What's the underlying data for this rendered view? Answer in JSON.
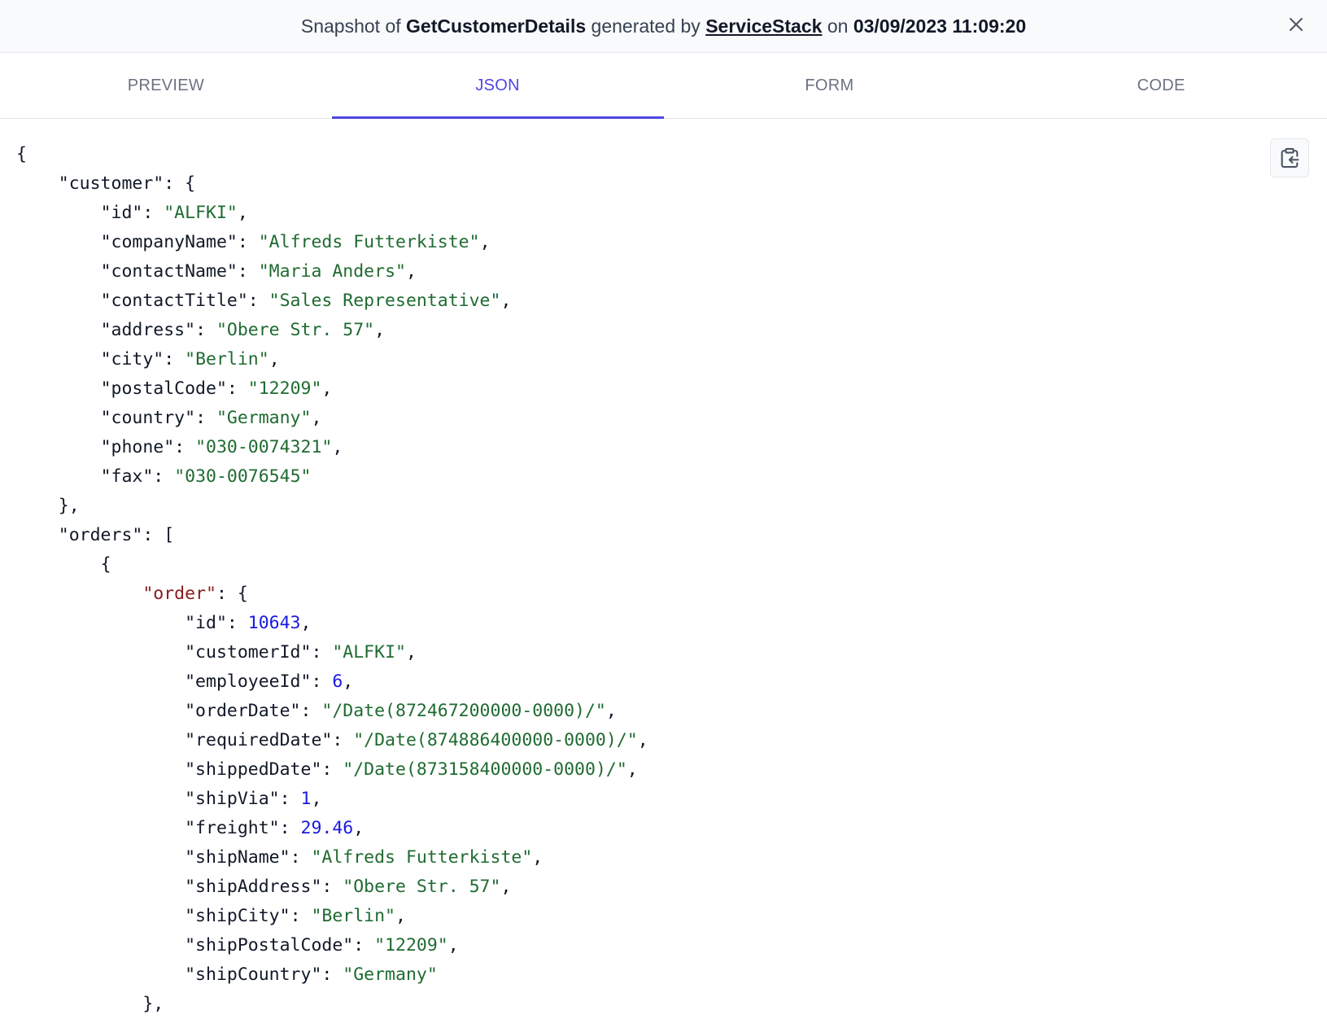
{
  "header": {
    "snapshot_prefix": "Snapshot of",
    "operation": "GetCustomerDetails",
    "generated_by": "generated by",
    "generator": "ServiceStack",
    "on": "on",
    "timestamp": "03/09/2023 11:09:20",
    "close_icon": "close-icon"
  },
  "tabs": [
    {
      "label": "PREVIEW",
      "active": false
    },
    {
      "label": "JSON",
      "active": true
    },
    {
      "label": "FORM",
      "active": false
    },
    {
      "label": "CODE",
      "active": false
    }
  ],
  "copy_icon": "clipboard-copy-icon",
  "colors": {
    "accent": "#4f46e5",
    "string": "#1f6b31",
    "number": "#1a1adf",
    "nested_key": "#8b1a1a"
  },
  "json_lines": [
    {
      "indent": 0,
      "parts": [
        {
          "t": "{",
          "c": "p"
        }
      ]
    },
    {
      "indent": 1,
      "parts": [
        {
          "t": "\"customer\"",
          "c": "k"
        },
        {
          "t": ": {",
          "c": "p"
        }
      ]
    },
    {
      "indent": 2,
      "parts": [
        {
          "t": "\"id\"",
          "c": "k"
        },
        {
          "t": ": ",
          "c": "p"
        },
        {
          "t": "\"ALFKI\"",
          "c": "s"
        },
        {
          "t": ",",
          "c": "p"
        }
      ]
    },
    {
      "indent": 2,
      "parts": [
        {
          "t": "\"companyName\"",
          "c": "k"
        },
        {
          "t": ": ",
          "c": "p"
        },
        {
          "t": "\"Alfreds Futterkiste\"",
          "c": "s"
        },
        {
          "t": ",",
          "c": "p"
        }
      ]
    },
    {
      "indent": 2,
      "parts": [
        {
          "t": "\"contactName\"",
          "c": "k"
        },
        {
          "t": ": ",
          "c": "p"
        },
        {
          "t": "\"Maria Anders\"",
          "c": "s"
        },
        {
          "t": ",",
          "c": "p"
        }
      ]
    },
    {
      "indent": 2,
      "parts": [
        {
          "t": "\"contactTitle\"",
          "c": "k"
        },
        {
          "t": ": ",
          "c": "p"
        },
        {
          "t": "\"Sales Representative\"",
          "c": "s"
        },
        {
          "t": ",",
          "c": "p"
        }
      ]
    },
    {
      "indent": 2,
      "parts": [
        {
          "t": "\"address\"",
          "c": "k"
        },
        {
          "t": ": ",
          "c": "p"
        },
        {
          "t": "\"Obere Str. 57\"",
          "c": "s"
        },
        {
          "t": ",",
          "c": "p"
        }
      ]
    },
    {
      "indent": 2,
      "parts": [
        {
          "t": "\"city\"",
          "c": "k"
        },
        {
          "t": ": ",
          "c": "p"
        },
        {
          "t": "\"Berlin\"",
          "c": "s"
        },
        {
          "t": ",",
          "c": "p"
        }
      ]
    },
    {
      "indent": 2,
      "parts": [
        {
          "t": "\"postalCode\"",
          "c": "k"
        },
        {
          "t": ": ",
          "c": "p"
        },
        {
          "t": "\"12209\"",
          "c": "s"
        },
        {
          "t": ",",
          "c": "p"
        }
      ]
    },
    {
      "indent": 2,
      "parts": [
        {
          "t": "\"country\"",
          "c": "k"
        },
        {
          "t": ": ",
          "c": "p"
        },
        {
          "t": "\"Germany\"",
          "c": "s"
        },
        {
          "t": ",",
          "c": "p"
        }
      ]
    },
    {
      "indent": 2,
      "parts": [
        {
          "t": "\"phone\"",
          "c": "k"
        },
        {
          "t": ": ",
          "c": "p"
        },
        {
          "t": "\"030-0074321\"",
          "c": "s"
        },
        {
          "t": ",",
          "c": "p"
        }
      ]
    },
    {
      "indent": 2,
      "parts": [
        {
          "t": "\"fax\"",
          "c": "k"
        },
        {
          "t": ": ",
          "c": "p"
        },
        {
          "t": "\"030-0076545\"",
          "c": "s"
        }
      ]
    },
    {
      "indent": 1,
      "parts": [
        {
          "t": "},",
          "c": "p"
        }
      ]
    },
    {
      "indent": 1,
      "parts": [
        {
          "t": "\"orders\"",
          "c": "k"
        },
        {
          "t": ": [",
          "c": "p"
        }
      ]
    },
    {
      "indent": 2,
      "parts": [
        {
          "t": "{",
          "c": "p"
        }
      ]
    },
    {
      "indent": 3,
      "parts": [
        {
          "t": "\"order\"",
          "c": "ko"
        },
        {
          "t": ": {",
          "c": "p"
        }
      ]
    },
    {
      "indent": 4,
      "parts": [
        {
          "t": "\"id\"",
          "c": "k"
        },
        {
          "t": ": ",
          "c": "p"
        },
        {
          "t": "10643",
          "c": "n"
        },
        {
          "t": ",",
          "c": "p"
        }
      ]
    },
    {
      "indent": 4,
      "parts": [
        {
          "t": "\"customerId\"",
          "c": "k"
        },
        {
          "t": ": ",
          "c": "p"
        },
        {
          "t": "\"ALFKI\"",
          "c": "s"
        },
        {
          "t": ",",
          "c": "p"
        }
      ]
    },
    {
      "indent": 4,
      "parts": [
        {
          "t": "\"employeeId\"",
          "c": "k"
        },
        {
          "t": ": ",
          "c": "p"
        },
        {
          "t": "6",
          "c": "n"
        },
        {
          "t": ",",
          "c": "p"
        }
      ]
    },
    {
      "indent": 4,
      "parts": [
        {
          "t": "\"orderDate\"",
          "c": "k"
        },
        {
          "t": ": ",
          "c": "p"
        },
        {
          "t": "\"/Date(872467200000-0000)/\"",
          "c": "s"
        },
        {
          "t": ",",
          "c": "p"
        }
      ]
    },
    {
      "indent": 4,
      "parts": [
        {
          "t": "\"requiredDate\"",
          "c": "k"
        },
        {
          "t": ": ",
          "c": "p"
        },
        {
          "t": "\"/Date(874886400000-0000)/\"",
          "c": "s"
        },
        {
          "t": ",",
          "c": "p"
        }
      ]
    },
    {
      "indent": 4,
      "parts": [
        {
          "t": "\"shippedDate\"",
          "c": "k"
        },
        {
          "t": ": ",
          "c": "p"
        },
        {
          "t": "\"/Date(873158400000-0000)/\"",
          "c": "s"
        },
        {
          "t": ",",
          "c": "p"
        }
      ]
    },
    {
      "indent": 4,
      "parts": [
        {
          "t": "\"shipVia\"",
          "c": "k"
        },
        {
          "t": ": ",
          "c": "p"
        },
        {
          "t": "1",
          "c": "n"
        },
        {
          "t": ",",
          "c": "p"
        }
      ]
    },
    {
      "indent": 4,
      "parts": [
        {
          "t": "\"freight\"",
          "c": "k"
        },
        {
          "t": ": ",
          "c": "p"
        },
        {
          "t": "29.46",
          "c": "n"
        },
        {
          "t": ",",
          "c": "p"
        }
      ]
    },
    {
      "indent": 4,
      "parts": [
        {
          "t": "\"shipName\"",
          "c": "k"
        },
        {
          "t": ": ",
          "c": "p"
        },
        {
          "t": "\"Alfreds Futterkiste\"",
          "c": "s"
        },
        {
          "t": ",",
          "c": "p"
        }
      ]
    },
    {
      "indent": 4,
      "parts": [
        {
          "t": "\"shipAddress\"",
          "c": "k"
        },
        {
          "t": ": ",
          "c": "p"
        },
        {
          "t": "\"Obere Str. 57\"",
          "c": "s"
        },
        {
          "t": ",",
          "c": "p"
        }
      ]
    },
    {
      "indent": 4,
      "parts": [
        {
          "t": "\"shipCity\"",
          "c": "k"
        },
        {
          "t": ": ",
          "c": "p"
        },
        {
          "t": "\"Berlin\"",
          "c": "s"
        },
        {
          "t": ",",
          "c": "p"
        }
      ]
    },
    {
      "indent": 4,
      "parts": [
        {
          "t": "\"shipPostalCode\"",
          "c": "k"
        },
        {
          "t": ": ",
          "c": "p"
        },
        {
          "t": "\"12209\"",
          "c": "s"
        },
        {
          "t": ",",
          "c": "p"
        }
      ]
    },
    {
      "indent": 4,
      "parts": [
        {
          "t": "\"shipCountry\"",
          "c": "k"
        },
        {
          "t": ": ",
          "c": "p"
        },
        {
          "t": "\"Germany\"",
          "c": "s"
        }
      ]
    },
    {
      "indent": 3,
      "parts": [
        {
          "t": "},",
          "c": "p"
        }
      ]
    }
  ]
}
